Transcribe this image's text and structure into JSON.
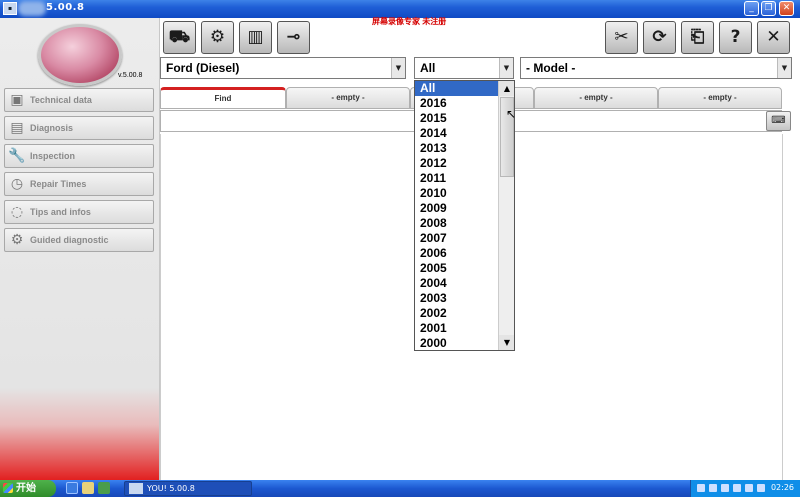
{
  "window": {
    "title": "5.00.8"
  },
  "sidebar": {
    "version": "v.5.00.8",
    "items": [
      {
        "label": "Technical data",
        "icon": "car-icon"
      },
      {
        "label": "Diagnosis",
        "icon": "diagnosis-icon"
      },
      {
        "label": "Inspection",
        "icon": "wrench-icon"
      },
      {
        "label": "Repair Times",
        "icon": "clock-icon"
      },
      {
        "label": "Tips and infos",
        "icon": "lightbulb-icon"
      },
      {
        "label": "Guided diagnostic",
        "icon": "guided-diagnostic-icon"
      }
    ]
  },
  "toolbar": {
    "left_icons": [
      "car-group-icon",
      "engine-icon",
      "battery-icon",
      "connector-icon"
    ],
    "right_icons": [
      "tools-icon",
      "sync-icon",
      "gift-icon",
      "help-icon",
      "close-icon"
    ],
    "help_label": "?",
    "close_label": "✕"
  },
  "notice": "屏幕录像专家 未注册",
  "selectors": {
    "make": "Ford (Diesel)",
    "year": "All",
    "model": "- Model -"
  },
  "tabs": [
    {
      "label": "Find"
    },
    {
      "label": "- empty -"
    },
    {
      "label": "- empty -"
    },
    {
      "label": "- empty -"
    },
    {
      "label": "- empty -"
    }
  ],
  "year_dropdown": {
    "options": [
      "All",
      "2016",
      "2015",
      "2014",
      "2013",
      "2012",
      "2011",
      "2010",
      "2009",
      "2008",
      "2007",
      "2006",
      "2005",
      "2004",
      "2003",
      "2002",
      "2001",
      "2000"
    ],
    "selected": "All"
  },
  "taskbar": {
    "start_label": "开始",
    "task_label": "YOU! 5.00.8",
    "clock": "02:26"
  },
  "colors": {
    "accent_red": "#d42020",
    "selection_blue": "#3169c6",
    "titlebar_blue": "#1f5fd6"
  }
}
